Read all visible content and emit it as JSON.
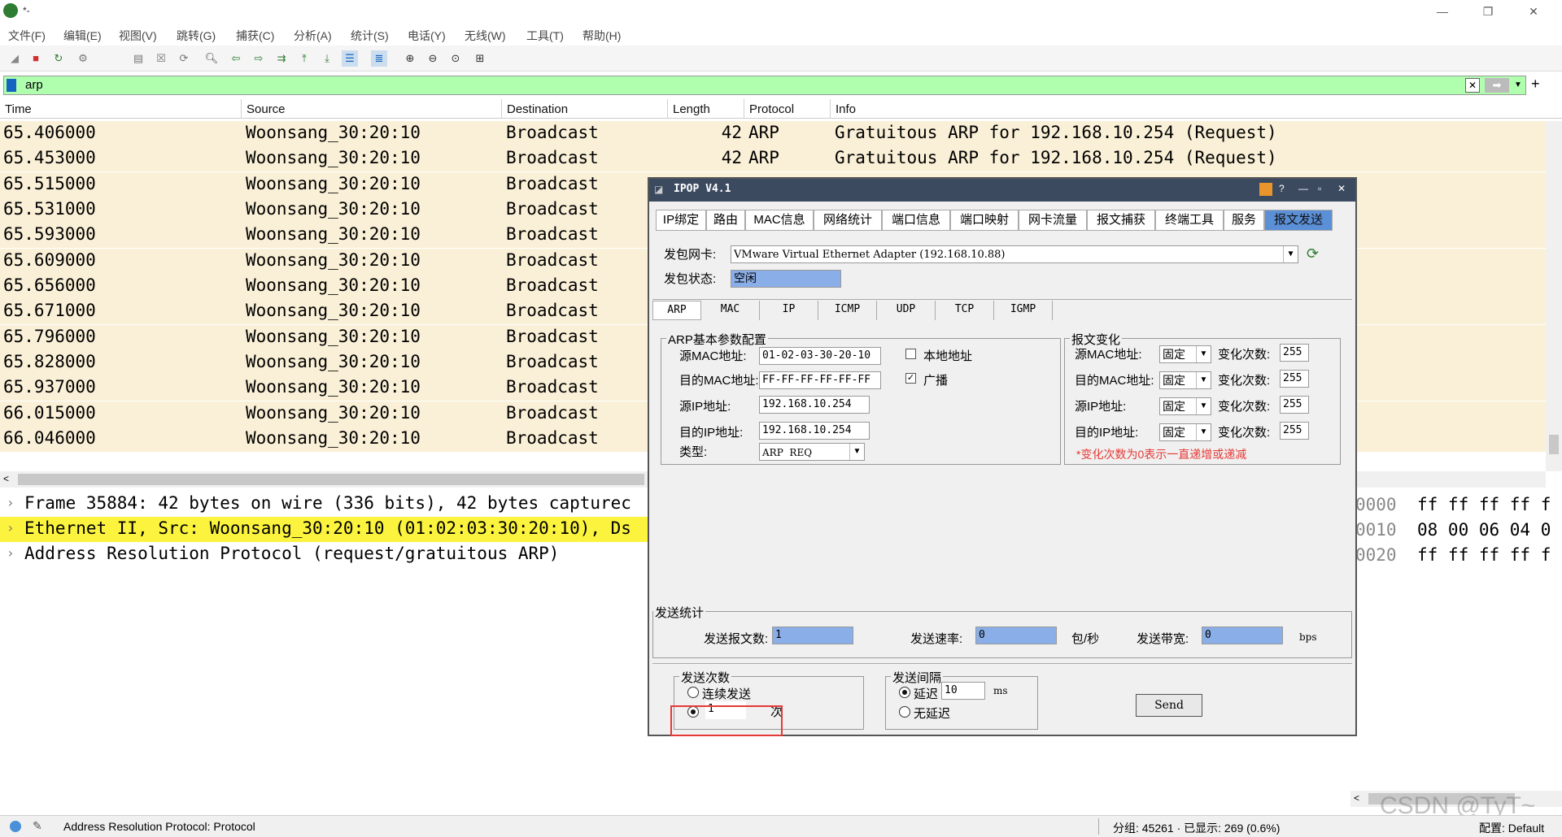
{
  "window": {
    "title": "*-",
    "minimize": "—",
    "maximize": "❐",
    "close": "✕"
  },
  "menu": [
    "文件(F)",
    "编辑(E)",
    "视图(V)",
    "跳转(G)",
    "捕获(C)",
    "分析(A)",
    "统计(S)",
    "电话(Y)",
    "无线(W)",
    "工具(T)",
    "帮助(H)"
  ],
  "filter": {
    "value": "arp"
  },
  "packet_list": {
    "columns": [
      "Time",
      "Source",
      "Destination",
      "Length",
      "Protocol",
      "Info"
    ],
    "rows": [
      [
        "65.406000",
        "Woonsang_30:20:10",
        "Broadcast",
        "42",
        "ARP",
        "Gratuitous ARP for 192.168.10.254 (Request)"
      ],
      [
        "65.453000",
        "Woonsang_30:20:10",
        "Broadcast",
        "42",
        "ARP",
        "Gratuitous ARP for 192.168.10.254 (Request)"
      ],
      [
        "65.515000",
        "Woonsang_30:20:10",
        "Broadcast",
        "",
        "",
        ""
      ],
      [
        "65.531000",
        "Woonsang_30:20:10",
        "Broadcast",
        "",
        "",
        ""
      ],
      [
        "65.593000",
        "Woonsang_30:20:10",
        "Broadcast",
        "",
        "",
        ""
      ],
      [
        "65.609000",
        "Woonsang_30:20:10",
        "Broadcast",
        "",
        "",
        ""
      ],
      [
        "65.656000",
        "Woonsang_30:20:10",
        "Broadcast",
        "",
        "",
        ""
      ],
      [
        "65.671000",
        "Woonsang_30:20:10",
        "Broadcast",
        "",
        "",
        ""
      ],
      [
        "65.796000",
        "Woonsang_30:20:10",
        "Broadcast",
        "",
        "",
        ""
      ],
      [
        "65.828000",
        "Woonsang_30:20:10",
        "Broadcast",
        "",
        "",
        ""
      ],
      [
        "65.937000",
        "Woonsang_30:20:10",
        "Broadcast",
        "",
        "",
        ""
      ],
      [
        "66.015000",
        "Woonsang_30:20:10",
        "Broadcast",
        "",
        "",
        ""
      ],
      [
        "66.046000",
        "Woonsang_30:20:10",
        "Broadcast",
        "",
        "",
        ""
      ]
    ]
  },
  "detail": [
    "Frame 35884: 42 bytes on wire (336 bits), 42 bytes capturec",
    "Ethernet II, Src: Woonsang_30:20:10 (01:02:03:30:20:10), Ds",
    "Address Resolution Protocol (request/gratuitous ARP)"
  ],
  "hex": [
    {
      "off": "0000",
      "bytes": "ff ff ff ff f"
    },
    {
      "off": "0010",
      "bytes": "08 00 06 04 0"
    },
    {
      "off": "0020",
      "bytes": "ff ff ff ff f"
    }
  ],
  "status": {
    "left": "Address Resolution Protocol: Protocol",
    "packets": "分组: 45261 · 已显示: 269 (0.6%)",
    "profile": "配置: Default"
  },
  "ipop": {
    "title": "IPOP V4.1",
    "tabs": [
      "IP绑定",
      "路由",
      "MAC信息",
      "网络统计",
      "端口信息",
      "端口映射",
      "网卡流量",
      "报文捕获",
      "终端工具",
      "服务",
      "报文发送"
    ],
    "nic_label": "发包网卡:",
    "nic_value": "VMware Virtual Ethernet Adapter (192.168.10.88)",
    "state_label": "发包状态:",
    "state_value": "空闲",
    "subtabs": [
      "ARP",
      "MAC",
      "IP",
      "ICMP",
      "UDP",
      "TCP",
      "IGMP"
    ],
    "arp_group": {
      "title": "ARP基本参数配置",
      "src_mac_label": "源MAC地址:",
      "src_mac": "01-02-03-30-20-10",
      "local_addr": "本地地址",
      "dst_mac_label": "目的MAC地址:",
      "dst_mac": "FF-FF-FF-FF-FF-FF",
      "broadcast": "广播",
      "src_ip_label": "源IP地址:",
      "src_ip": "192.168.10.254",
      "dst_ip_label": "目的IP地址:",
      "dst_ip": "192.168.10.254",
      "type_label": "类型:",
      "type_value": "ARP  REQ"
    },
    "change_group": {
      "title": "报文变化",
      "rows": [
        {
          "label": "源MAC地址:",
          "mode": "固定",
          "count_label": "变化次数:",
          "count": "255"
        },
        {
          "label": "目的MAC地址:",
          "mode": "固定",
          "count_label": "变化次数:",
          "count": "255"
        },
        {
          "label": "源IP地址:",
          "mode": "固定",
          "count_label": "变化次数:",
          "count": "255"
        },
        {
          "label": "目的IP地址:",
          "mode": "固定",
          "count_label": "变化次数:",
          "count": "255"
        }
      ],
      "note": "*变化次数为0表示一直递增或递减"
    },
    "stats": {
      "title": "发送统计",
      "sent_label": "发送报文数:",
      "sent": "1",
      "rate_label": "发送速率:",
      "rate": "0",
      "rate_unit": "包/秒",
      "bw_label": "发送带宽:",
      "bw": "0",
      "bw_unit": "bps"
    },
    "count_group": {
      "title": "发送次数",
      "continuous": "连续发送",
      "count_value": "1",
      "count_unit": "次"
    },
    "interval_group": {
      "title": "发送间隔",
      "delay": "延迟",
      "delay_value": "10",
      "delay_unit": "ms",
      "no_delay": "无延迟"
    },
    "send": "Send"
  },
  "watermark": "CSDN @TyT~"
}
